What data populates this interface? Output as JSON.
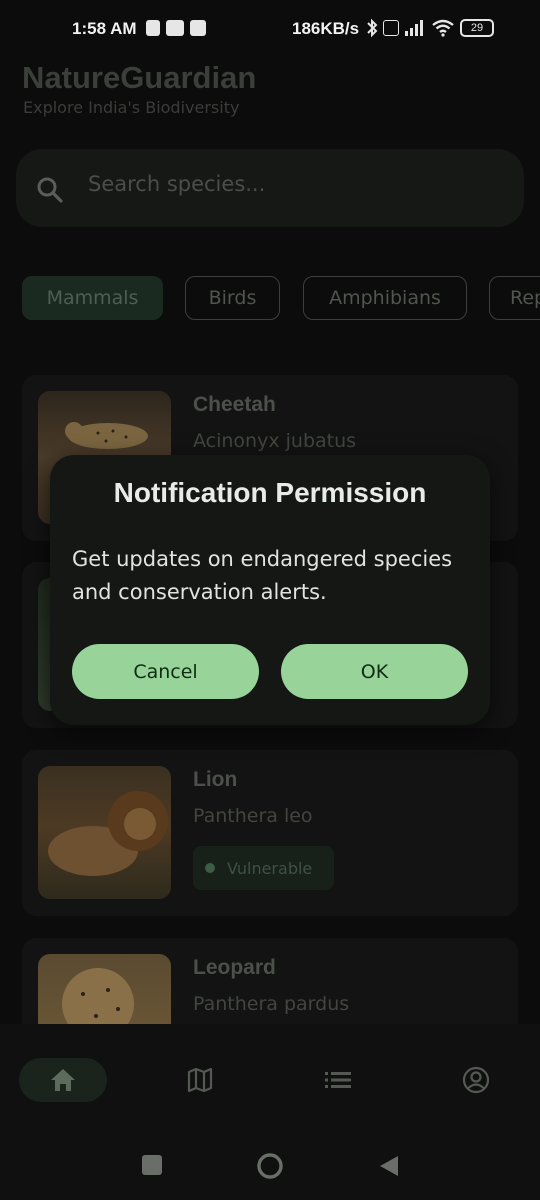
{
  "status_bar": {
    "time": "1:58 AM",
    "net_speed": "186KB/s",
    "battery": "29"
  },
  "header": {
    "title": "NatureGuardian",
    "subtitle": "Explore India's Biodiversity"
  },
  "search": {
    "placeholder": "Search species..."
  },
  "categories": [
    "Mammals",
    "Birds",
    "Amphibians",
    "Rep"
  ],
  "selected_category": "Mammals",
  "species": [
    {
      "name": "Cheetah",
      "scientific": "Acinonyx jubatus",
      "status": ""
    },
    {
      "name": "",
      "scientific": "",
      "status": ""
    },
    {
      "name": "Lion",
      "scientific": "Panthera leo",
      "status": "Vulnerable"
    },
    {
      "name": "Leopard",
      "scientific": "Panthera pardus",
      "status": ""
    }
  ],
  "dialog": {
    "title": "Notification Permission",
    "body": "Get updates on endangered species and conservation alerts.",
    "cancel_label": "Cancel",
    "ok_label": "OK"
  },
  "bottom_nav": {
    "items": [
      "home-icon",
      "map-icon",
      "list-icon",
      "profile-icon"
    ],
    "active": "home-icon"
  },
  "colors": {
    "accent": "#98d39a",
    "background": "#0b0c0b",
    "card": "#121312"
  }
}
